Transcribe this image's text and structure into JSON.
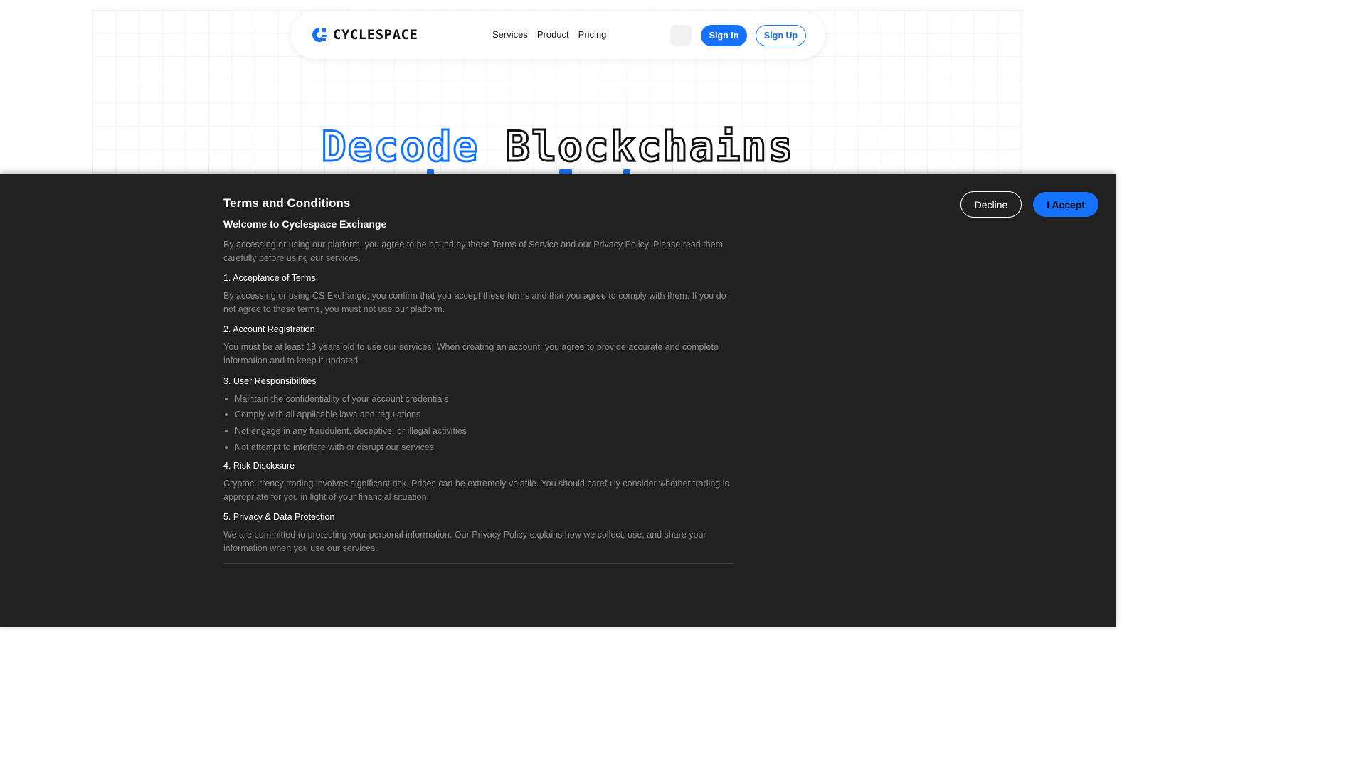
{
  "navbar": {
    "brand": "CYCLESPACE",
    "links": [
      "Services",
      "Product",
      "Pricing"
    ],
    "sign_in": "Sign In",
    "sign_up": "Sign Up"
  },
  "hero": {
    "title_accent": "Decode",
    "title_rest": "Blockchains"
  },
  "terms": {
    "title": "Terms and Conditions",
    "subtitle": "Welcome to Cyclespace Exchange",
    "intro": "By accessing or using our platform, you agree to be bound by these Terms of Service and our Privacy Policy. Please read them carefully before using our services.",
    "sections": [
      {
        "heading": "1. Acceptance of Terms",
        "body": "By accessing or using CS Exchange, you confirm that you accept these terms and that you agree to comply with them. If you do not agree to these terms, you must not use our platform."
      },
      {
        "heading": "2. Account Registration",
        "body": "You must be at least 18 years old to use our services. When creating an account, you agree to provide accurate and complete information and to keep it updated."
      },
      {
        "heading": "3. User Responsibilities",
        "items": [
          "Maintain the confidentiality of your account credentials",
          "Comply with all applicable laws and regulations",
          "Not engage in any fraudulent, deceptive, or illegal activities",
          "Not attempt to interfere with or disrupt our services"
        ]
      },
      {
        "heading": "4. Risk Disclosure",
        "body": "Cryptocurrency trading involves significant risk. Prices can be extremely volatile. You should carefully consider whether trading is appropriate for you in light of your financial situation."
      },
      {
        "heading": "5. Privacy & Data Protection",
        "body": "We are committed to protecting your personal information. Our Privacy Policy explains how we collect, use, and share your information when you use our services."
      }
    ],
    "decline": "Decline",
    "accept": "I Accept"
  },
  "colors": {
    "accent": "#1472ff",
    "overlay_bg": "#212121",
    "muted_text": "#8c8c8c"
  },
  "icons": {
    "logo": "cyclespace-logo-icon"
  }
}
